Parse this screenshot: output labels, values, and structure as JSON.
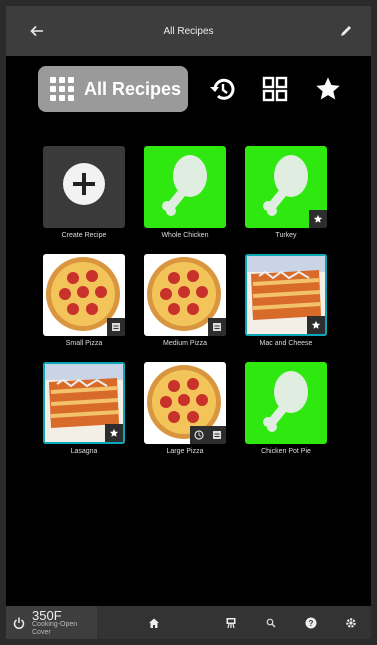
{
  "header": {
    "title": "All Recipes",
    "back_icon": "arrow-left-icon",
    "edit_icon": "pencil-icon"
  },
  "categories": {
    "all_label": "All Recipes",
    "all_icon": "grid-dots-icon",
    "history_icon": "history-icon",
    "grid_icon": "grid-view-icon",
    "favorites_icon": "star-icon",
    "selected_color": "#9a9a9a"
  },
  "recipes": [
    {
      "name": "Create Recipe",
      "image": "plus-icon"
    },
    {
      "name": "Whole Chicken",
      "image": "drumstick-icon"
    },
    {
      "name": "Turkey",
      "image": "drumstick-icon",
      "badges": [
        "star-icon"
      ]
    },
    {
      "name": "Small Pizza",
      "image": "pizza-photo",
      "badges": [
        "list-icon"
      ]
    },
    {
      "name": "Medium Pizza",
      "image": "pizza-photo",
      "badges": [
        "list-icon"
      ]
    },
    {
      "name": "Mac and Cheese",
      "image": "pasta-photo",
      "badges": [
        "star-icon"
      ]
    },
    {
      "name": "Lasagna",
      "image": "pasta-photo",
      "badges": [
        "star-icon"
      ]
    },
    {
      "name": "Large Pizza",
      "image": "pizza-photo",
      "badges": [
        "clock-icon",
        "list-icon"
      ]
    },
    {
      "name": "Chicken Pot Pie",
      "image": "drumstick-icon"
    }
  ],
  "status": {
    "temperature": "350F",
    "state": "Cooking-Open Cover",
    "power_icon": "power-icon"
  },
  "bottom_nav": [
    "home-icon",
    "grill-icon",
    "search-icon",
    "help-icon",
    "settings-icon"
  ],
  "colors": {
    "accent_green": "#2ee80f",
    "teal_border": "#0aa7b8",
    "background": "#000000"
  }
}
